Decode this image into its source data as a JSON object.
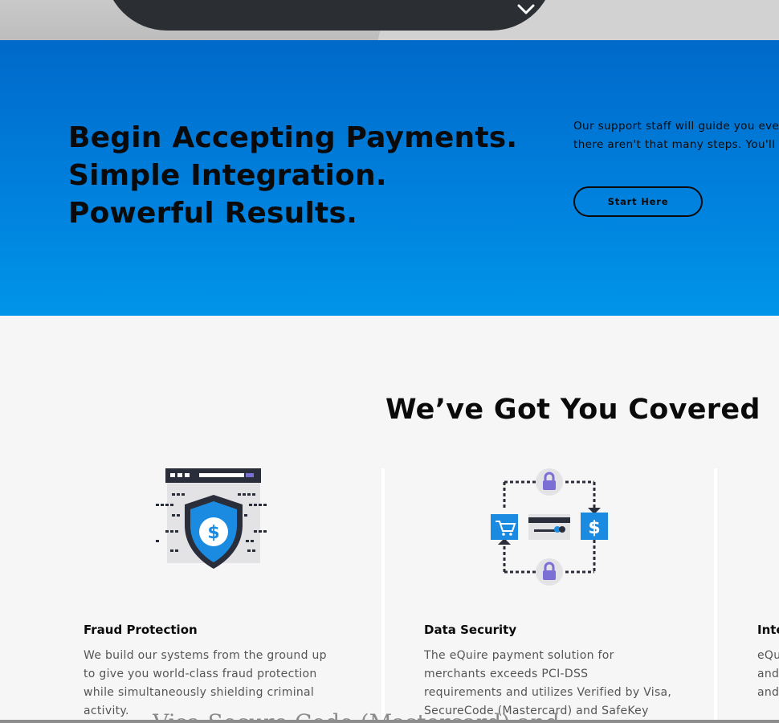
{
  "cta": {
    "headline": [
      "Begin Accepting Payments.",
      "Simple Integration.",
      "Powerful Results."
    ],
    "copy": [
      "Our support staff will guide you eve",
      "there aren't that many steps. You'll"
    ],
    "button_label": "Start Here"
  },
  "covered": {
    "title": "We’ve Got You Covered",
    "features": [
      {
        "title": "Fraud Protection",
        "icon": "shield-dollar-icon",
        "lines": [
          "We build our systems from the ground up",
          "to give you world-class fraud protection",
          "while simultaneously shielding criminal",
          "activity."
        ]
      },
      {
        "title": "Data Security",
        "icon": "payment-cycle-lock-icon",
        "lines": [
          "The eQuire payment solution for",
          "merchants exceeds PCI-DSS",
          "requirements and utilizes Verified by Visa,",
          "SecureCode (Mastercard) and SafeKey"
        ]
      },
      {
        "title": "Inte",
        "lines": [
          "eQu",
          "and",
          "and"
        ]
      }
    ]
  },
  "footer_ghost": "Visa Secure Code (Mastercard) and",
  "colors": {
    "band_top": "#0069c9",
    "band_bottom": "#0095e8",
    "icon_blue": "#1a8be0",
    "icon_purple": "#7b6fd6",
    "icon_dark": "#2a2d3a"
  }
}
